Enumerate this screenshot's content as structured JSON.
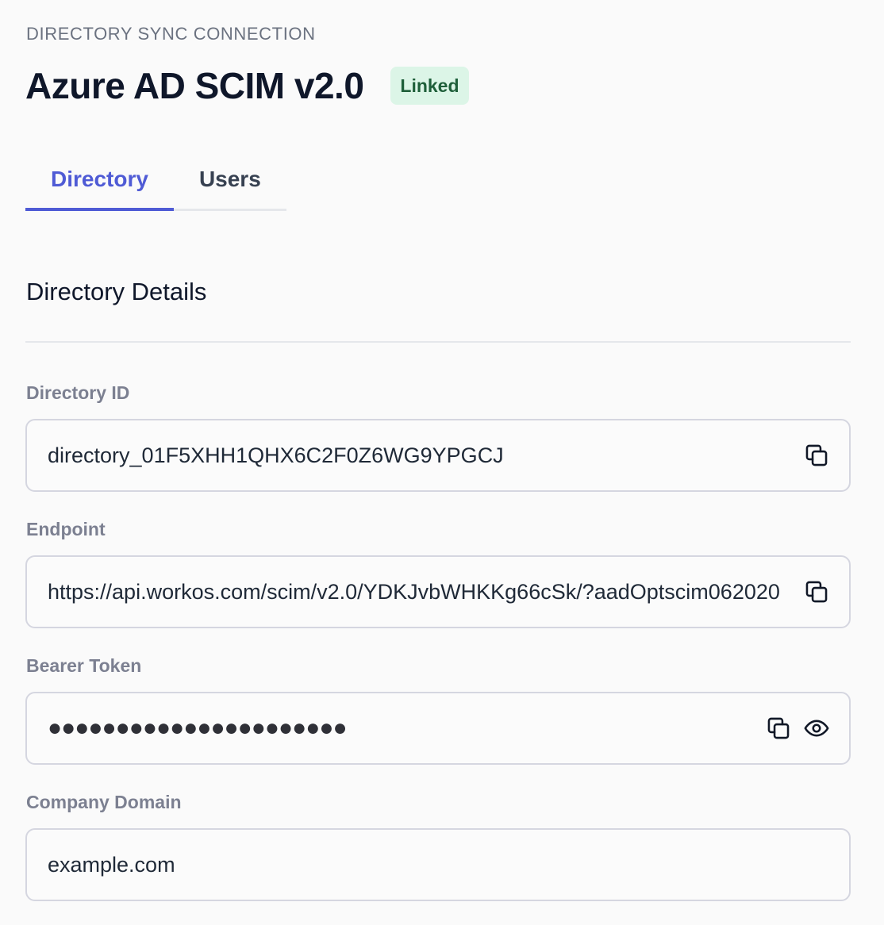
{
  "header": {
    "eyebrow": "DIRECTORY SYNC CONNECTION",
    "title": "Azure AD SCIM v2.0",
    "status_badge": "Linked"
  },
  "tabs": [
    {
      "label": "Directory",
      "active": true
    },
    {
      "label": "Users",
      "active": false
    }
  ],
  "section": {
    "title": "Directory Details"
  },
  "fields": {
    "directory_id": {
      "label": "Directory ID",
      "value": "directory_01F5XHH1QHX6C2F0Z6WG9YPGCJ"
    },
    "endpoint": {
      "label": "Endpoint",
      "value": "https://api.workos.com/scim/v2.0/YDKJvbWHKKg66cSk/?aadOptscim062020"
    },
    "bearer_token": {
      "label": "Bearer Token",
      "value": "●●●●●●●●●●●●●●●●●●●●●●"
    },
    "company_domain": {
      "label": "Company Domain",
      "value": "example.com"
    }
  },
  "icons": {
    "copy": "copy-icon",
    "reveal": "eye-icon"
  },
  "colors": {
    "accent": "#4f5bd5",
    "badge_bg": "#dcf5e7",
    "badge_text": "#1f5f3a",
    "label": "#7c8091"
  }
}
